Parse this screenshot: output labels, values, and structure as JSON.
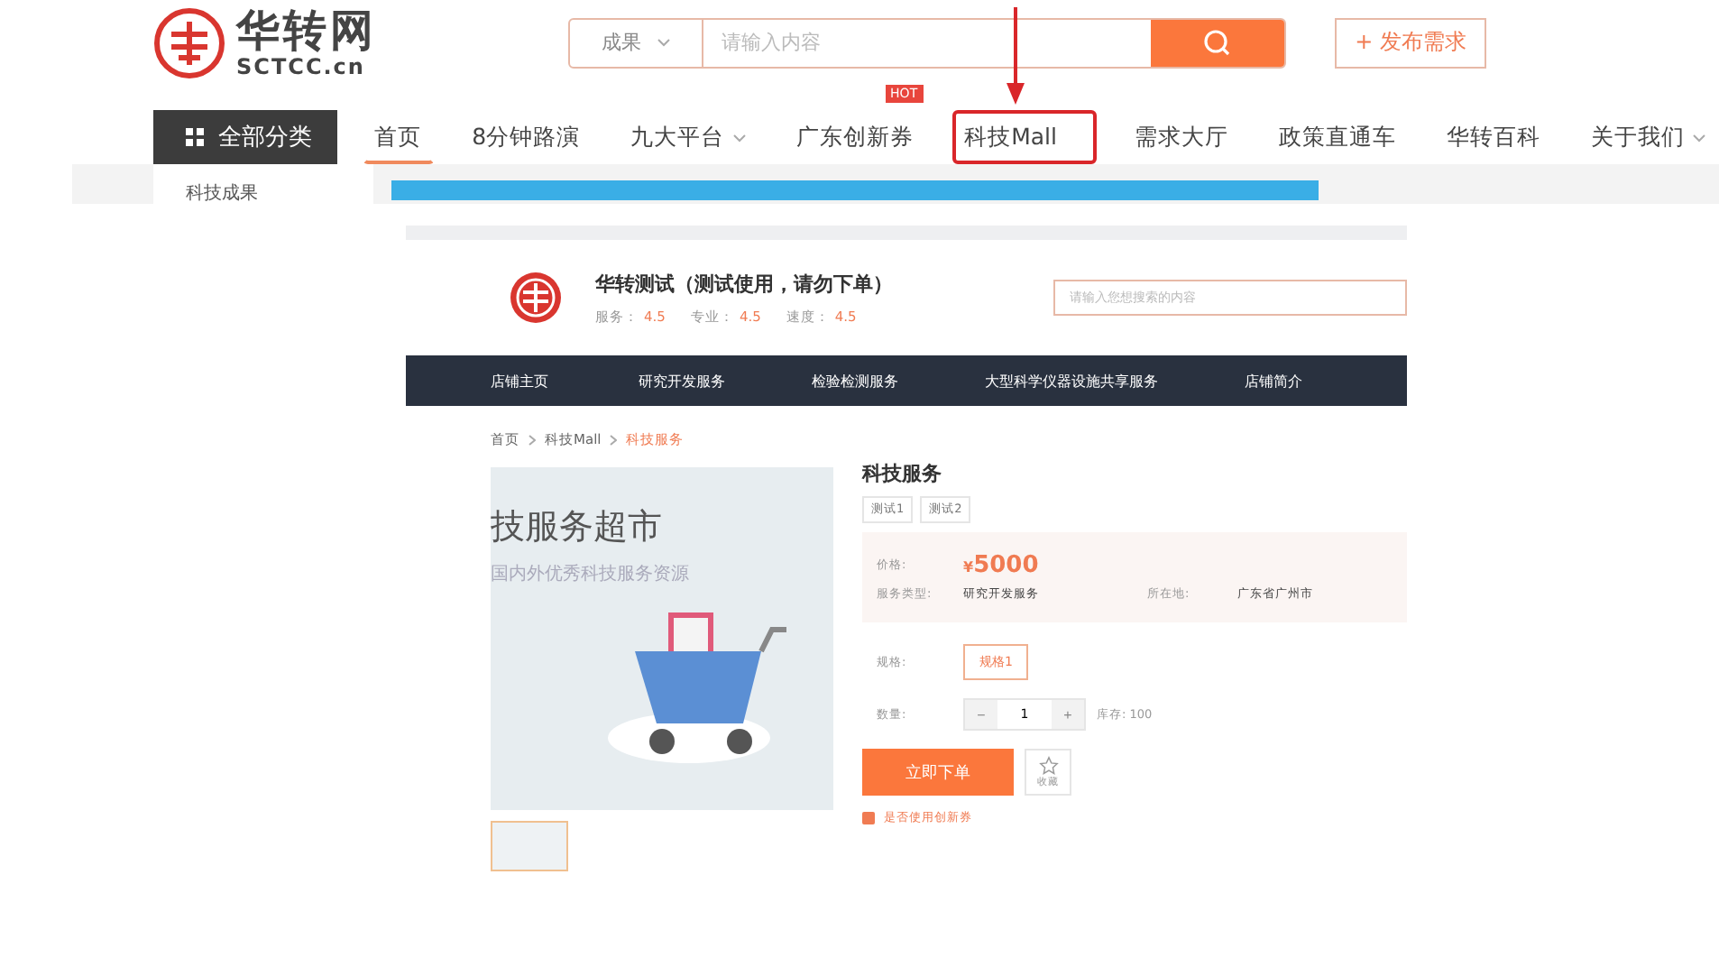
{
  "header": {
    "logo": {
      "name": "华转网",
      "domain": "SCTCC.cn"
    },
    "search": {
      "category": "成果",
      "placeholder": "请输入内容"
    },
    "publish_button": "+ 发布需求"
  },
  "nav": {
    "all_categories": "全部分类",
    "items": [
      {
        "label": "首页",
        "selected": true,
        "dropdown": false,
        "highlighted": false
      },
      {
        "label": "8分钟路演",
        "selected": false,
        "dropdown": false,
        "highlighted": false
      },
      {
        "label": "九大平台",
        "selected": false,
        "dropdown": true,
        "highlighted": false
      },
      {
        "label": "广东创新券",
        "selected": false,
        "dropdown": false,
        "highlighted": false,
        "badge": "HOT"
      },
      {
        "label": "科技Mall",
        "selected": false,
        "dropdown": false,
        "highlighted": true
      },
      {
        "label": "需求大厅",
        "selected": false,
        "dropdown": false,
        "highlighted": false
      },
      {
        "label": "政策直通车",
        "selected": false,
        "dropdown": false,
        "highlighted": false
      },
      {
        "label": "华转百科",
        "selected": false,
        "dropdown": false,
        "highlighted": false
      },
      {
        "label": "关于我们",
        "selected": false,
        "dropdown": true,
        "highlighted": false
      }
    ]
  },
  "sidebar": {
    "items": [
      "科技成果"
    ]
  },
  "store": {
    "name": "华转测试（测试使用，请勿下单）",
    "ratings": [
      {
        "label": "服务：",
        "value": "4.5"
      },
      {
        "label": "专业：",
        "value": "4.5"
      },
      {
        "label": "速度：",
        "value": "4.5"
      }
    ],
    "search": {
      "placeholder": "请输入您想搜索的内容"
    },
    "nav": [
      "店铺主页",
      "研究开发服务",
      "检验检测服务",
      "大型科学仪器设施共享服务",
      "店铺简介"
    ],
    "breadcrumb": [
      {
        "label": "首页",
        "current": false
      },
      {
        "label": "科技Mall",
        "current": false
      },
      {
        "label": "科技服务",
        "current": true
      }
    ],
    "product": {
      "banner_title": "技服务超市",
      "banner_subtitle": "国内外优秀科技服务资源",
      "title": "科技服务",
      "tags": [
        "测试1",
        "测试2"
      ],
      "price_label": "价格:",
      "currency": "¥",
      "price": "5000",
      "info": [
        {
          "label": "服务类型:",
          "value": "研究开发服务"
        },
        {
          "label": "所在地:",
          "value": "广东省广州市"
        }
      ],
      "spec_label": "规格:",
      "specs": [
        {
          "label": "规格1",
          "selected": true
        }
      ],
      "quantity_label": "数量:",
      "quantity": "1",
      "minus": "−",
      "plus": "+",
      "stock": "库存: 100",
      "order_button": "立即下单",
      "favorite": "收藏",
      "coupon": {
        "label": "是否使用创新券",
        "checked": true
      }
    }
  }
}
